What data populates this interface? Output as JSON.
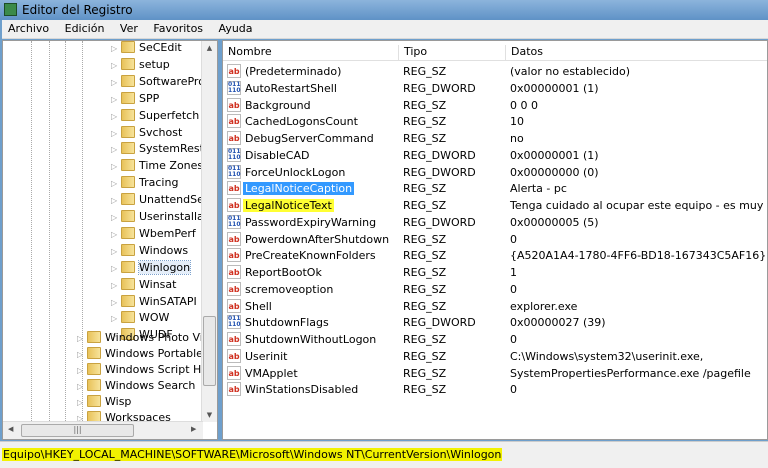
{
  "window": {
    "title": "Editor del Registro"
  },
  "menu": [
    "Archivo",
    "Edición",
    "Ver",
    "Favoritos",
    "Ayuda"
  ],
  "tree": {
    "children": [
      "SeCEdit",
      "setup",
      "SoftwareProt",
      "SPP",
      "Superfetch",
      "Svchost",
      "SystemResto",
      "Time Zones",
      "Tracing",
      "UnattendSett",
      "Userinstallab",
      "WbemPerf",
      "Windows",
      "Winlogon",
      "Winsat",
      "WinSATAPI",
      "WOW",
      "WUDF"
    ],
    "selected": "Winlogon",
    "siblings": [
      "Windows Photo View",
      "Windows Portable D",
      "Windows Script Hos",
      "Windows Search",
      "Wisp",
      "Workspaces"
    ]
  },
  "list": {
    "columns": {
      "name": "Nombre",
      "type": "Tipo",
      "data": "Datos"
    },
    "rows": [
      {
        "name": "(Predeterminado)",
        "type": "REG_SZ",
        "data": "(valor no establecido)"
      },
      {
        "name": "AutoRestartShell",
        "type": "REG_DWORD",
        "data": "0x00000001 (1)"
      },
      {
        "name": "Background",
        "type": "REG_SZ",
        "data": "0 0 0"
      },
      {
        "name": "CachedLogonsCount",
        "type": "REG_SZ",
        "data": "10"
      },
      {
        "name": "DebugServerCommand",
        "type": "REG_SZ",
        "data": "no"
      },
      {
        "name": "DisableCAD",
        "type": "REG_DWORD",
        "data": "0x00000001 (1)"
      },
      {
        "name": "ForceUnlockLogon",
        "type": "REG_DWORD",
        "data": "0x00000000 (0)"
      },
      {
        "name": "LegalNoticeCaption",
        "type": "REG_SZ",
        "data": "Alerta - pc",
        "state": "selected"
      },
      {
        "name": "LegalNoticeText",
        "type": "REG_SZ",
        "data": "Tenga cuidado al ocupar este equipo - es muy caro",
        "state": "highlighted"
      },
      {
        "name": "PasswordExpiryWarning",
        "type": "REG_DWORD",
        "data": "0x00000005 (5)"
      },
      {
        "name": "PowerdownAfterShutdown",
        "type": "REG_SZ",
        "data": "0"
      },
      {
        "name": "PreCreateKnownFolders",
        "type": "REG_SZ",
        "data": "{A520A1A4-1780-4FF6-BD18-167343C5AF16}"
      },
      {
        "name": "ReportBootOk",
        "type": "REG_SZ",
        "data": "1"
      },
      {
        "name": "scremoveoption",
        "type": "REG_SZ",
        "data": "0"
      },
      {
        "name": "Shell",
        "type": "REG_SZ",
        "data": "explorer.exe"
      },
      {
        "name": "ShutdownFlags",
        "type": "REG_DWORD",
        "data": "0x00000027 (39)"
      },
      {
        "name": "ShutdownWithoutLogon",
        "type": "REG_SZ",
        "data": "0"
      },
      {
        "name": "Userinit",
        "type": "REG_SZ",
        "data": "C:\\Windows\\system32\\userinit.exe,"
      },
      {
        "name": "VMApplet",
        "type": "REG_SZ",
        "data": "SystemPropertiesPerformance.exe /pagefile"
      },
      {
        "name": "WinStationsDisabled",
        "type": "REG_SZ",
        "data": "0"
      }
    ]
  },
  "status": {
    "path": "Equipo\\HKEY_LOCAL_MACHINE\\SOFTWARE\\Microsoft\\Windows NT\\CurrentVersion\\Winlogon"
  },
  "colors": {
    "selection": "#3399ff",
    "highlight": "#ffff33",
    "status_highlight": "#f2f200"
  }
}
